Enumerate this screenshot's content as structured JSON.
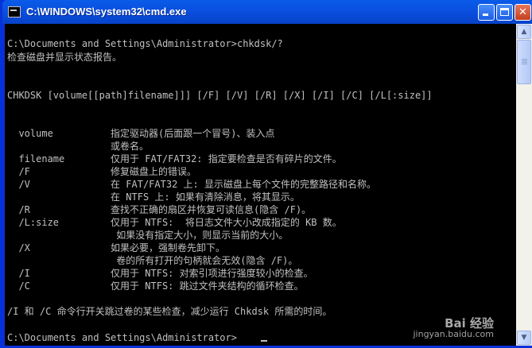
{
  "window": {
    "title": "C:\\WINDOWS\\system32\\cmd.exe",
    "min_glyph": "",
    "max_glyph": "",
    "close_glyph": "✕"
  },
  "console": {
    "lines": [
      "C:\\Documents and Settings\\Administrator>chkdsk/?",
      "检查磁盘并显示状态报告。",
      "CHKDSK [volume[[path]filename]]] [/F] [/V] [/R] [/X] [/I] [/C] [/L[:size]]",
      "  volume          指定驱动器(后面跟一个冒号)、装入点",
      "                  或卷名。",
      "  filename        仅用于 FAT/FAT32: 指定要检查是否有碎片的文件。",
      "  /F              修复磁盘上的错误。",
      "  /V              在 FAT/FAT32 上: 显示磁盘上每个文件的完整路径和名称。",
      "                  在 NTFS 上: 如果有清除消息，将其显示。",
      "  /R              查找不正确的扇区并恢复可读信息(隐含 /F)。",
      "  /L:size         仅用于 NTFS:  将日志文件大小改成指定的 KB 数。",
      "                   如果没有指定大小，则显示当前的大小。",
      "  /X              如果必要，强制卷先卸下。",
      "                   卷的所有打开的句柄就会无效(隐含 /F)。",
      "  /I              仅用于 NTFS: 对索引项进行强度较小的检查。",
      "  /C              仅用于 NTFS: 跳过文件夹结构的循环检查。",
      "/I 和 /C 命令行开关跳过卷的某些检查，减少运行 Chkdsk 所需的时间。",
      "C:\\Documents and Settings\\Administrator>"
    ]
  },
  "scrollbar": {
    "up_glyph": "▲",
    "down_glyph": "▼"
  },
  "watermark": {
    "brand": "Bai 经验",
    "url": "jingyan.baidu.com"
  }
}
